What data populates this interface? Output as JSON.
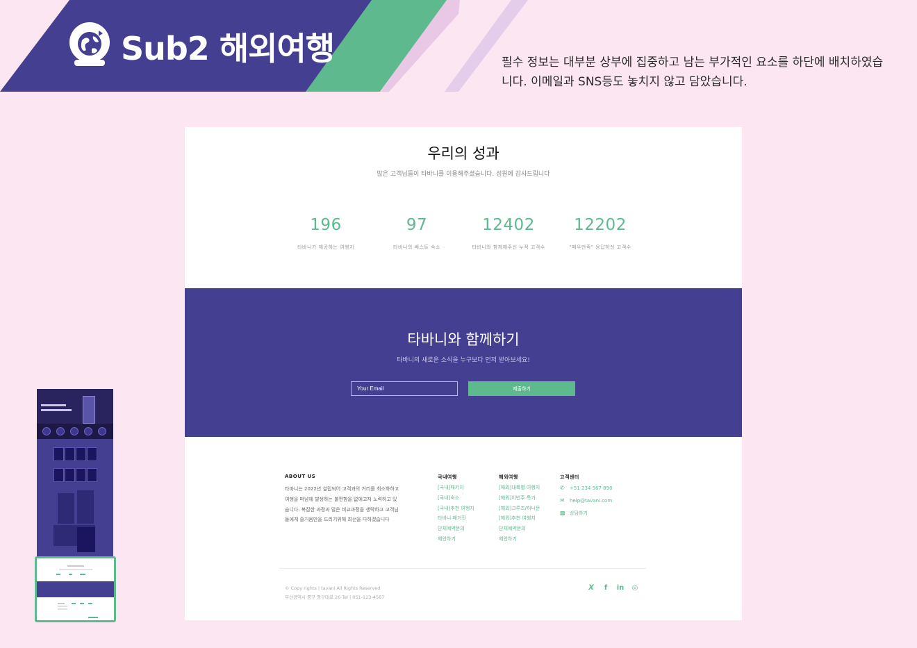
{
  "banner": {
    "title": "Sub2 해외여행",
    "description": "필수 정보는 대부분 상부에 집중하고 남는 부가적인 요소를 하단에 배치하였습니다. 이메일과 SNS등도 놓치지 않고 담았습니다.",
    "colors": {
      "primary": "#453f92",
      "accent": "#5fb98f",
      "background": "#fce6f2"
    }
  },
  "achievements": {
    "title": "우리의 성과",
    "subtitle": "많은 고객님들이 타바니를 이용해주셨습니다. 성원에 감사드립니다",
    "stats": [
      {
        "value": "196",
        "label": "타바니가 제공하는 여행지"
      },
      {
        "value": "97",
        "label": "타바니의 베스트 숙소"
      },
      {
        "value": "12402",
        "label": "타바니와 함께해주신 누적 고객수"
      },
      {
        "value": "12202",
        "label": "\"매우만족\" 응답하신 고객수"
      }
    ]
  },
  "newsletter": {
    "title": "타바니와 함께하기",
    "subtitle": "타바니의 새로운 소식을 누구보다 먼저 받아보세요!",
    "email_placeholder": "Your Email",
    "submit_label": "제출하기"
  },
  "footer": {
    "about": {
      "heading": "ABOUT US",
      "text": "타바니는 2022년 설립되어 고객과의 거리를 최소화하고 여행을 떠남에 발생하는 불편함을 없애고자 노력하고 있습니다. 복잡한 과정과 많은 비교과정을 생략하고 고객님들에게 즐거움만을 드리기위해 최선을 다하겠습니다"
    },
    "domestic": {
      "heading": "국내여행",
      "items": [
        "[국내]패키지",
        "[국내]숙소",
        "[국내]추천 여행지",
        "타바니 매거진",
        "단체예약문의",
        "제안하기"
      ]
    },
    "overseas": {
      "heading": "해외여행",
      "items": [
        "[해외]대륙별 여행지",
        "[해외]이번주 특가",
        "[해외]크루즈/허니문",
        "[해외]추천 여행지",
        "단체예약문의",
        "제안하기"
      ]
    },
    "support": {
      "heading": "고객센터",
      "phone": "+51 234 567 890",
      "email": "help@tavani.com",
      "chat": "상담하기",
      "icons": [
        "phone-icon",
        "mail-icon",
        "chat-icon"
      ]
    },
    "copyright": "© Copy rights | tavani All Rights Reserved",
    "address": "부산광역시 중구 중구대로 26 Tel | 051-123-4567",
    "social_icons": [
      "twitter-icon",
      "facebook-icon",
      "linkedin-icon",
      "dribbble-icon"
    ]
  }
}
